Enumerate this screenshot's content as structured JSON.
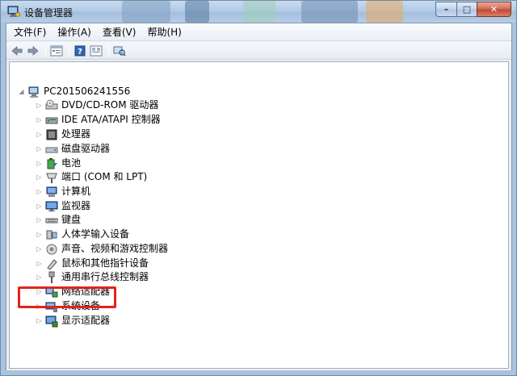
{
  "window": {
    "title": "设备管理器",
    "buttons": {
      "minimize": "–",
      "maximize": "□",
      "close": "✕"
    }
  },
  "menu": [
    "文件(F)",
    "操作(A)",
    "查看(V)",
    "帮助(H)"
  ],
  "toolbar": [
    "back-arrow-icon",
    "forward-arrow-icon",
    "properties-icon",
    "help-icon",
    "view-icon",
    "scan-hardware-icon"
  ],
  "tree": {
    "root": "PC201506241556",
    "items": [
      {
        "label": "DVD/CD-ROM 驱动器",
        "icon": "dvd-drive-icon"
      },
      {
        "label": "IDE ATA/ATAPI 控制器",
        "icon": "ide-controller-icon"
      },
      {
        "label": "处理器",
        "icon": "processor-icon"
      },
      {
        "label": "磁盘驱动器",
        "icon": "disk-drive-icon"
      },
      {
        "label": "电池",
        "icon": "battery-icon"
      },
      {
        "label": "端口 (COM 和 LPT)",
        "icon": "port-icon"
      },
      {
        "label": "计算机",
        "icon": "computer-icon"
      },
      {
        "label": "监视器",
        "icon": "monitor-icon"
      },
      {
        "label": "键盘",
        "icon": "keyboard-icon"
      },
      {
        "label": "人体学输入设备",
        "icon": "hid-icon"
      },
      {
        "label": "声音、视频和游戏控制器",
        "icon": "sound-icon"
      },
      {
        "label": "鼠标和其他指针设备",
        "icon": "mouse-icon"
      },
      {
        "label": "通用串行总线控制器",
        "icon": "usb-icon"
      },
      {
        "label": "网络适配器",
        "icon": "network-adapter-icon"
      },
      {
        "label": "系统设备",
        "icon": "system-device-icon"
      },
      {
        "label": "显示适配器",
        "icon": "display-adapter-icon"
      }
    ]
  },
  "highlight": {
    "target": "显示适配器",
    "color": "#e2231a"
  }
}
